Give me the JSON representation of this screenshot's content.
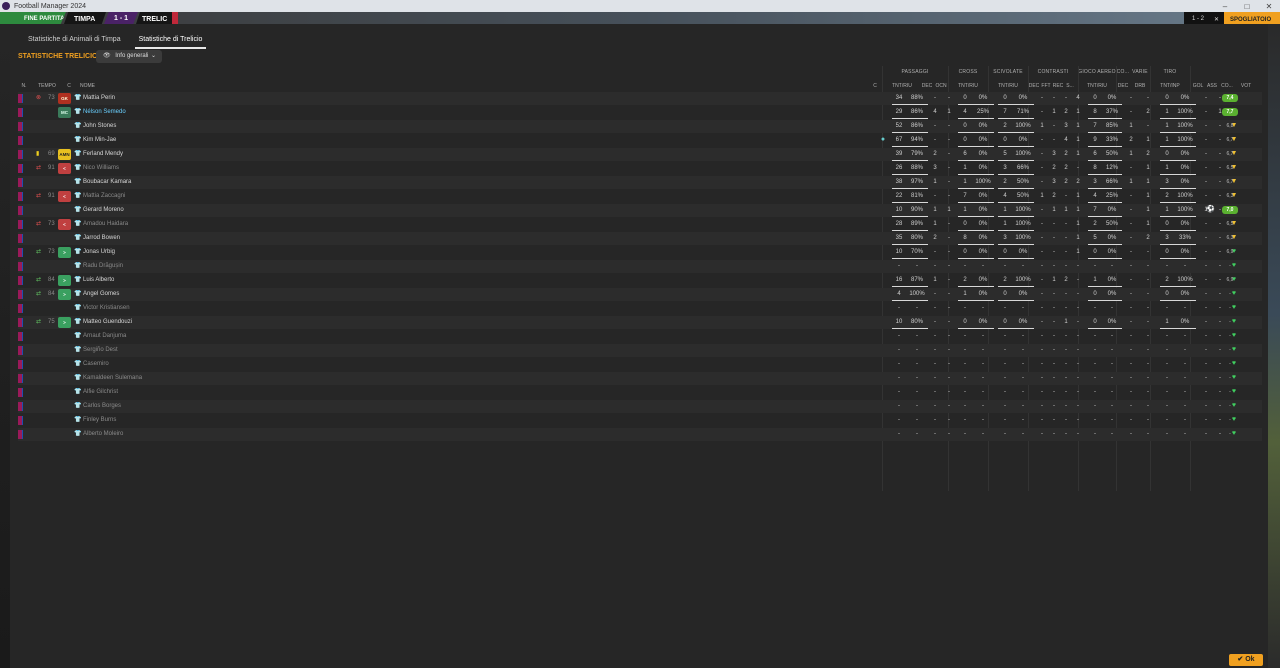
{
  "window": {
    "title": "Football Manager 2024"
  },
  "topbar": {
    "match_end": "FINE PARTITA",
    "home": "TIMPA",
    "score": "1 - 1",
    "away": "TRELIC",
    "score_right": "1 - 2",
    "btn": "SPOGLIATOIO"
  },
  "tabs": [
    {
      "label": "Statistiche di Animali di Timpa",
      "active": false
    },
    {
      "label": "Statistiche di Trelicio",
      "active": true
    }
  ],
  "section_title": "STATISTICHE TRELICIO",
  "view_dropdown": "Info generali",
  "groups": [
    "PASSAGGI",
    "CROSS",
    "SCIVOLATE",
    "CONTRASTI",
    "GIOCO AEREO",
    "CO...",
    "VARIE",
    "TIRO"
  ],
  "headers": {
    "n": "N.",
    "tempo": "TEMPO",
    "c": "C",
    "nome": "NOME",
    "cap": "C",
    "pass": "TNT/RIU",
    "pass_dec": "DEC",
    "pass_occ": "OCN",
    "cross": "TNT/RIU",
    "sciv": "TNT/RIU",
    "contr_dec": "DEC",
    "contr_fft": "FFT",
    "contr_rec": "REC",
    "contr_s": "S...",
    "aereo": "TNT/RIU",
    "co_dec": "DEC",
    "varie_drb": "DRB",
    "tiro": "TNT/INP",
    "gol": "GOL",
    "ass": "ASS",
    "co": "CO...",
    "vot": "VOT"
  },
  "players": [
    {
      "min": "73",
      "pos": "GK",
      "pos_class": "gk",
      "name": "Mattia Perin",
      "p": "34",
      "pp": "88%",
      "pd": "-",
      "po": "-",
      "cr": "0",
      "crp": "0%",
      "sc": "0",
      "scp": "0%",
      "cd": "-",
      "cf": "-",
      "cre": "-",
      "cs": "4",
      "ae": "0",
      "aep": "0%",
      "cod": "-",
      "drb": "-",
      "ti": "0",
      "tip": "0%",
      "gol": "-",
      "ass": "-",
      "vote": "7,4",
      "vote_hi": true,
      "yellow": false,
      "sub": "",
      "dim": false,
      "link": false
    },
    {
      "min": "",
      "pos": "MC",
      "pos_class": "mc",
      "name": "Nélson Semedo",
      "p": "29",
      "pp": "86%",
      "pd": "4",
      "po": "1",
      "cr": "4",
      "crp": "25%",
      "sc": "7",
      "scp": "71%",
      "cd": "-",
      "cf": "1",
      "cre": "2",
      "cs": "1",
      "ae": "8",
      "aep": "37%",
      "cod": "-",
      "drb": "2",
      "ti": "1",
      "tip": "100%",
      "gol": "-",
      "ass": "1",
      "vote": "7,7",
      "vote_hi": true,
      "yellow": false,
      "sub": "",
      "dim": false,
      "link": true
    },
    {
      "min": "",
      "pos": "",
      "pos_class": "",
      "name": "John Stones",
      "p": "52",
      "pp": "86%",
      "pd": "-",
      "po": "-",
      "cr": "0",
      "crp": "0%",
      "sc": "2",
      "scp": "100%",
      "cd": "1",
      "cf": "-",
      "cre": "3",
      "cs": "1",
      "ae": "7",
      "aep": "85%",
      "cod": "1",
      "drb": "-",
      "ti": "1",
      "tip": "100%",
      "gol": "-",
      "ass": "-",
      "vote": "6,8",
      "vote_hi": false,
      "yellow": false,
      "sub": "",
      "dim": false,
      "link": false
    },
    {
      "min": "",
      "pos": "",
      "pos_class": "",
      "name": "Kim Min-Jae",
      "p": "67",
      "pp": "94%",
      "pd": "-",
      "po": "-",
      "cr": "0",
      "crp": "0%",
      "sc": "0",
      "scp": "0%",
      "cd": "-",
      "cf": "-",
      "cre": "4",
      "cs": "1",
      "ae": "9",
      "aep": "33%",
      "cod": "2",
      "drb": "1",
      "ti": "1",
      "tip": "100%",
      "gol": "-",
      "ass": "-",
      "vote": "6,7",
      "vote_hi": false,
      "yellow": false,
      "sub": "",
      "dim": false,
      "link": false
    },
    {
      "min": "69",
      "pos": "AMN",
      "pos_class": "amn",
      "name": "Ferland Mendy",
      "p": "39",
      "pp": "79%",
      "pd": "2",
      "po": "-",
      "cr": "6",
      "crp": "0%",
      "sc": "5",
      "scp": "100%",
      "cd": "-",
      "cf": "3",
      "cre": "2",
      "cs": "1",
      "ae": "6",
      "aep": "50%",
      "cod": "1",
      "drb": "2",
      "ti": "0",
      "tip": "0%",
      "gol": "-",
      "ass": "-",
      "vote": "6,7",
      "vote_hi": false,
      "yellow": true,
      "sub": "",
      "dim": false,
      "link": false
    },
    {
      "min": "91",
      "pos": "<",
      "pos_class": "sub-out",
      "name": "Nico Williams",
      "p": "26",
      "pp": "88%",
      "pd": "3",
      "po": "-",
      "cr": "1",
      "crp": "0%",
      "sc": "3",
      "scp": "66%",
      "cd": "-",
      "cf": "2",
      "cre": "2",
      "cs": "-",
      "ae": "8",
      "aep": "12%",
      "cod": "-",
      "drb": "1",
      "ti": "1",
      "tip": "0%",
      "gol": "-",
      "ass": "-",
      "vote": "6,5",
      "vote_hi": false,
      "yellow": false,
      "sub": "out",
      "dim": true,
      "link": false
    },
    {
      "min": "",
      "pos": "",
      "pos_class": "",
      "name": "Boubacar Kamara",
      "p": "38",
      "pp": "97%",
      "pd": "1",
      "po": "-",
      "cr": "1",
      "crp": "100%",
      "sc": "2",
      "scp": "50%",
      "cd": "-",
      "cf": "3",
      "cre": "2",
      "cs": "2",
      "ae": "3",
      "aep": "66%",
      "cod": "1",
      "drb": "1",
      "ti": "3",
      "tip": "0%",
      "gol": "-",
      "ass": "-",
      "vote": "6,7",
      "vote_hi": false,
      "yellow": false,
      "sub": "",
      "dim": false,
      "link": false
    },
    {
      "min": "91",
      "pos": "<",
      "pos_class": "sub-out",
      "name": "Mattia Zaccagni",
      "p": "22",
      "pp": "81%",
      "pd": "-",
      "po": "-",
      "cr": "7",
      "crp": "0%",
      "sc": "4",
      "scp": "50%",
      "cd": "1",
      "cf": "2",
      "cre": "-",
      "cs": "1",
      "ae": "4",
      "aep": "25%",
      "cod": "-",
      "drb": "1",
      "ti": "2",
      "tip": "100%",
      "gol": "-",
      "ass": "-",
      "vote": "6,3",
      "vote_hi": false,
      "yellow": false,
      "sub": "out",
      "dim": true,
      "link": false
    },
    {
      "min": "",
      "pos": "",
      "pos_class": "",
      "name": "Gerard Moreno",
      "p": "10",
      "pp": "90%",
      "pd": "1",
      "po": "1",
      "cr": "1",
      "crp": "0%",
      "sc": "1",
      "scp": "100%",
      "cd": "-",
      "cf": "1",
      "cre": "1",
      "cs": "1",
      "ae": "7",
      "aep": "0%",
      "cod": "-",
      "drb": "1",
      "ti": "1",
      "tip": "100%",
      "gol": "1",
      "ass": "-",
      "vote": "7,0",
      "vote_hi": true,
      "yellow": false,
      "sub": "",
      "dim": false,
      "link": false
    },
    {
      "min": "73",
      "pos": "<",
      "pos_class": "sub-out",
      "name": "Amadou Haidara",
      "p": "28",
      "pp": "89%",
      "pd": "1",
      "po": "-",
      "cr": "0",
      "crp": "0%",
      "sc": "1",
      "scp": "100%",
      "cd": "-",
      "cf": "-",
      "cre": "-",
      "cs": "1",
      "ae": "2",
      "aep": "50%",
      "cod": "-",
      "drb": "1",
      "ti": "0",
      "tip": "0%",
      "gol": "-",
      "ass": "-",
      "vote": "6,5",
      "vote_hi": false,
      "yellow": false,
      "sub": "out",
      "dim": true,
      "link": false
    },
    {
      "min": "",
      "pos": "",
      "pos_class": "",
      "name": "Jarrod Bowen",
      "p": "35",
      "pp": "80%",
      "pd": "2",
      "po": "-",
      "cr": "8",
      "crp": "0%",
      "sc": "3",
      "scp": "100%",
      "cd": "-",
      "cf": "-",
      "cre": "-",
      "cs": "1",
      "ae": "5",
      "aep": "0%",
      "cod": "-",
      "drb": "2",
      "ti": "3",
      "tip": "33%",
      "gol": "-",
      "ass": "-",
      "vote": "6,3",
      "vote_hi": false,
      "yellow": false,
      "sub": "",
      "dim": false,
      "link": false
    },
    {
      "min": "73",
      "pos": ">",
      "pos_class": "sub-in",
      "name": "Jonas Urbig",
      "p": "10",
      "pp": "70%",
      "pd": "-",
      "po": "-",
      "cr": "0",
      "crp": "0%",
      "sc": "0",
      "scp": "0%",
      "cd": "-",
      "cf": "-",
      "cre": "-",
      "cs": "1",
      "ae": "0",
      "aep": "0%",
      "cod": "-",
      "drb": "-",
      "ti": "0",
      "tip": "0%",
      "gol": "-",
      "ass": "-",
      "vote": "6,9",
      "vote_hi": false,
      "yellow": false,
      "sub": "in",
      "dim": false,
      "link": false
    },
    {
      "min": "",
      "pos": "",
      "pos_class": "",
      "name": "Radu Drăgușin",
      "p": "-",
      "pp": "-",
      "pd": "-",
      "po": "-",
      "cr": "-",
      "crp": "-",
      "sc": "-",
      "scp": "-",
      "cd": "-",
      "cf": "-",
      "cre": "-",
      "cs": "-",
      "ae": "-",
      "aep": "-",
      "cod": "-",
      "drb": "-",
      "ti": "-",
      "tip": "-",
      "gol": "-",
      "ass": "-",
      "vote": "-",
      "vote_hi": false,
      "yellow": false,
      "sub": "",
      "dim": true,
      "link": false
    },
    {
      "min": "84",
      "pos": ">",
      "pos_class": "sub-in",
      "name": "Luis Alberto",
      "p": "16",
      "pp": "87%",
      "pd": "1",
      "po": "-",
      "cr": "2",
      "crp": "0%",
      "sc": "2",
      "scp": "100%",
      "cd": "-",
      "cf": "1",
      "cre": "2",
      "cs": "-",
      "ae": "1",
      "aep": "0%",
      "cod": "-",
      "drb": "-",
      "ti": "2",
      "tip": "100%",
      "gol": "-",
      "ass": "-",
      "vote": "6,9",
      "vote_hi": false,
      "yellow": false,
      "sub": "in",
      "dim": false,
      "link": false
    },
    {
      "min": "84",
      "pos": ">",
      "pos_class": "sub-in",
      "name": "Angel Gomes",
      "p": "4",
      "pp": "100%",
      "pd": "-",
      "po": "-",
      "cr": "1",
      "crp": "0%",
      "sc": "0",
      "scp": "0%",
      "cd": "-",
      "cf": "-",
      "cre": "-",
      "cs": "-",
      "ae": "0",
      "aep": "0%",
      "cod": "-",
      "drb": "-",
      "ti": "0",
      "tip": "0%",
      "gol": "-",
      "ass": "-",
      "vote": "-",
      "vote_hi": false,
      "yellow": false,
      "sub": "in",
      "dim": false,
      "link": false
    },
    {
      "min": "",
      "pos": "",
      "pos_class": "",
      "name": "Victor Kristiansen",
      "p": "-",
      "pp": "-",
      "pd": "-",
      "po": "-",
      "cr": "-",
      "crp": "-",
      "sc": "-",
      "scp": "-",
      "cd": "-",
      "cf": "-",
      "cre": "-",
      "cs": "-",
      "ae": "-",
      "aep": "-",
      "cod": "-",
      "drb": "-",
      "ti": "-",
      "tip": "-",
      "gol": "-",
      "ass": "-",
      "vote": "-",
      "vote_hi": false,
      "yellow": false,
      "sub": "",
      "dim": true,
      "link": false
    },
    {
      "min": "75",
      "pos": ">",
      "pos_class": "sub-in",
      "name": "Matteo Guendouzi",
      "p": "10",
      "pp": "80%",
      "pd": "-",
      "po": "-",
      "cr": "0",
      "crp": "0%",
      "sc": "0",
      "scp": "0%",
      "cd": "-",
      "cf": "-",
      "cre": "1",
      "cs": "-",
      "ae": "0",
      "aep": "0%",
      "cod": "-",
      "drb": "-",
      "ti": "1",
      "tip": "0%",
      "gol": "-",
      "ass": "-",
      "vote": "-",
      "vote_hi": false,
      "yellow": false,
      "sub": "in",
      "dim": false,
      "link": false
    },
    {
      "min": "",
      "pos": "",
      "pos_class": "",
      "name": "Arnaut Danjuma",
      "p": "-",
      "pp": "-",
      "pd": "-",
      "po": "-",
      "cr": "-",
      "crp": "-",
      "sc": "-",
      "scp": "-",
      "cd": "-",
      "cf": "-",
      "cre": "-",
      "cs": "-",
      "ae": "-",
      "aep": "-",
      "cod": "-",
      "drb": "-",
      "ti": "-",
      "tip": "-",
      "gol": "-",
      "ass": "-",
      "vote": "-",
      "vote_hi": false,
      "yellow": false,
      "sub": "",
      "dim": true,
      "link": false
    },
    {
      "min": "",
      "pos": "",
      "pos_class": "",
      "name": "Sergiño Dest",
      "p": "-",
      "pp": "-",
      "pd": "-",
      "po": "-",
      "cr": "-",
      "crp": "-",
      "sc": "-",
      "scp": "-",
      "cd": "-",
      "cf": "-",
      "cre": "-",
      "cs": "-",
      "ae": "-",
      "aep": "-",
      "cod": "-",
      "drb": "-",
      "ti": "-",
      "tip": "-",
      "gol": "-",
      "ass": "-",
      "vote": "-",
      "vote_hi": false,
      "yellow": false,
      "sub": "",
      "dim": true,
      "link": false
    },
    {
      "min": "",
      "pos": "",
      "pos_class": "",
      "name": "Casemiro",
      "p": "-",
      "pp": "-",
      "pd": "-",
      "po": "-",
      "cr": "-",
      "crp": "-",
      "sc": "-",
      "scp": "-",
      "cd": "-",
      "cf": "-",
      "cre": "-",
      "cs": "-",
      "ae": "-",
      "aep": "-",
      "cod": "-",
      "drb": "-",
      "ti": "-",
      "tip": "-",
      "gol": "-",
      "ass": "-",
      "vote": "-",
      "vote_hi": false,
      "yellow": false,
      "sub": "",
      "dim": true,
      "link": false
    },
    {
      "min": "",
      "pos": "",
      "pos_class": "",
      "name": "Kamaldeen Sulemana",
      "p": "-",
      "pp": "-",
      "pd": "-",
      "po": "-",
      "cr": "-",
      "crp": "-",
      "sc": "-",
      "scp": "-",
      "cd": "-",
      "cf": "-",
      "cre": "-",
      "cs": "-",
      "ae": "-",
      "aep": "-",
      "cod": "-",
      "drb": "-",
      "ti": "-",
      "tip": "-",
      "gol": "-",
      "ass": "-",
      "vote": "-",
      "vote_hi": false,
      "yellow": false,
      "sub": "",
      "dim": true,
      "link": false
    },
    {
      "min": "",
      "pos": "",
      "pos_class": "",
      "name": "Alfie Gilchrist",
      "p": "-",
      "pp": "-",
      "pd": "-",
      "po": "-",
      "cr": "-",
      "crp": "-",
      "sc": "-",
      "scp": "-",
      "cd": "-",
      "cf": "-",
      "cre": "-",
      "cs": "-",
      "ae": "-",
      "aep": "-",
      "cod": "-",
      "drb": "-",
      "ti": "-",
      "tip": "-",
      "gol": "-",
      "ass": "-",
      "vote": "-",
      "vote_hi": false,
      "yellow": false,
      "sub": "",
      "dim": true,
      "link": false
    },
    {
      "min": "",
      "pos": "",
      "pos_class": "",
      "name": "Carlos Borges",
      "p": "-",
      "pp": "-",
      "pd": "-",
      "po": "-",
      "cr": "-",
      "crp": "-",
      "sc": "-",
      "scp": "-",
      "cd": "-",
      "cf": "-",
      "cre": "-",
      "cs": "-",
      "ae": "-",
      "aep": "-",
      "cod": "-",
      "drb": "-",
      "ti": "-",
      "tip": "-",
      "gol": "-",
      "ass": "-",
      "vote": "-",
      "vote_hi": false,
      "yellow": false,
      "sub": "",
      "dim": true,
      "link": false
    },
    {
      "min": "",
      "pos": "",
      "pos_class": "",
      "name": "Finley Burns",
      "p": "-",
      "pp": "-",
      "pd": "-",
      "po": "-",
      "cr": "-",
      "crp": "-",
      "sc": "-",
      "scp": "-",
      "cd": "-",
      "cf": "-",
      "cre": "-",
      "cs": "-",
      "ae": "-",
      "aep": "-",
      "cod": "-",
      "drb": "-",
      "ti": "-",
      "tip": "-",
      "gol": "-",
      "ass": "-",
      "vote": "-",
      "vote_hi": false,
      "yellow": false,
      "sub": "",
      "dim": true,
      "link": false
    },
    {
      "min": "",
      "pos": "",
      "pos_class": "",
      "name": "Alberto Moleiro",
      "p": "-",
      "pp": "-",
      "pd": "-",
      "po": "-",
      "cr": "-",
      "crp": "-",
      "sc": "-",
      "scp": "-",
      "cd": "-",
      "cf": "-",
      "cre": "-",
      "cs": "-",
      "ae": "-",
      "aep": "-",
      "cod": "-",
      "drb": "-",
      "ti": "-",
      "tip": "-",
      "gol": "-",
      "ass": "-",
      "vote": "-",
      "vote_hi": false,
      "yellow": false,
      "sub": "",
      "dim": true,
      "link": false
    }
  ],
  "ok_label": "Ok",
  "colors": {
    "accent": "#f0a020",
    "vote_high": "#5ab030",
    "link": "#6ad0ff"
  }
}
